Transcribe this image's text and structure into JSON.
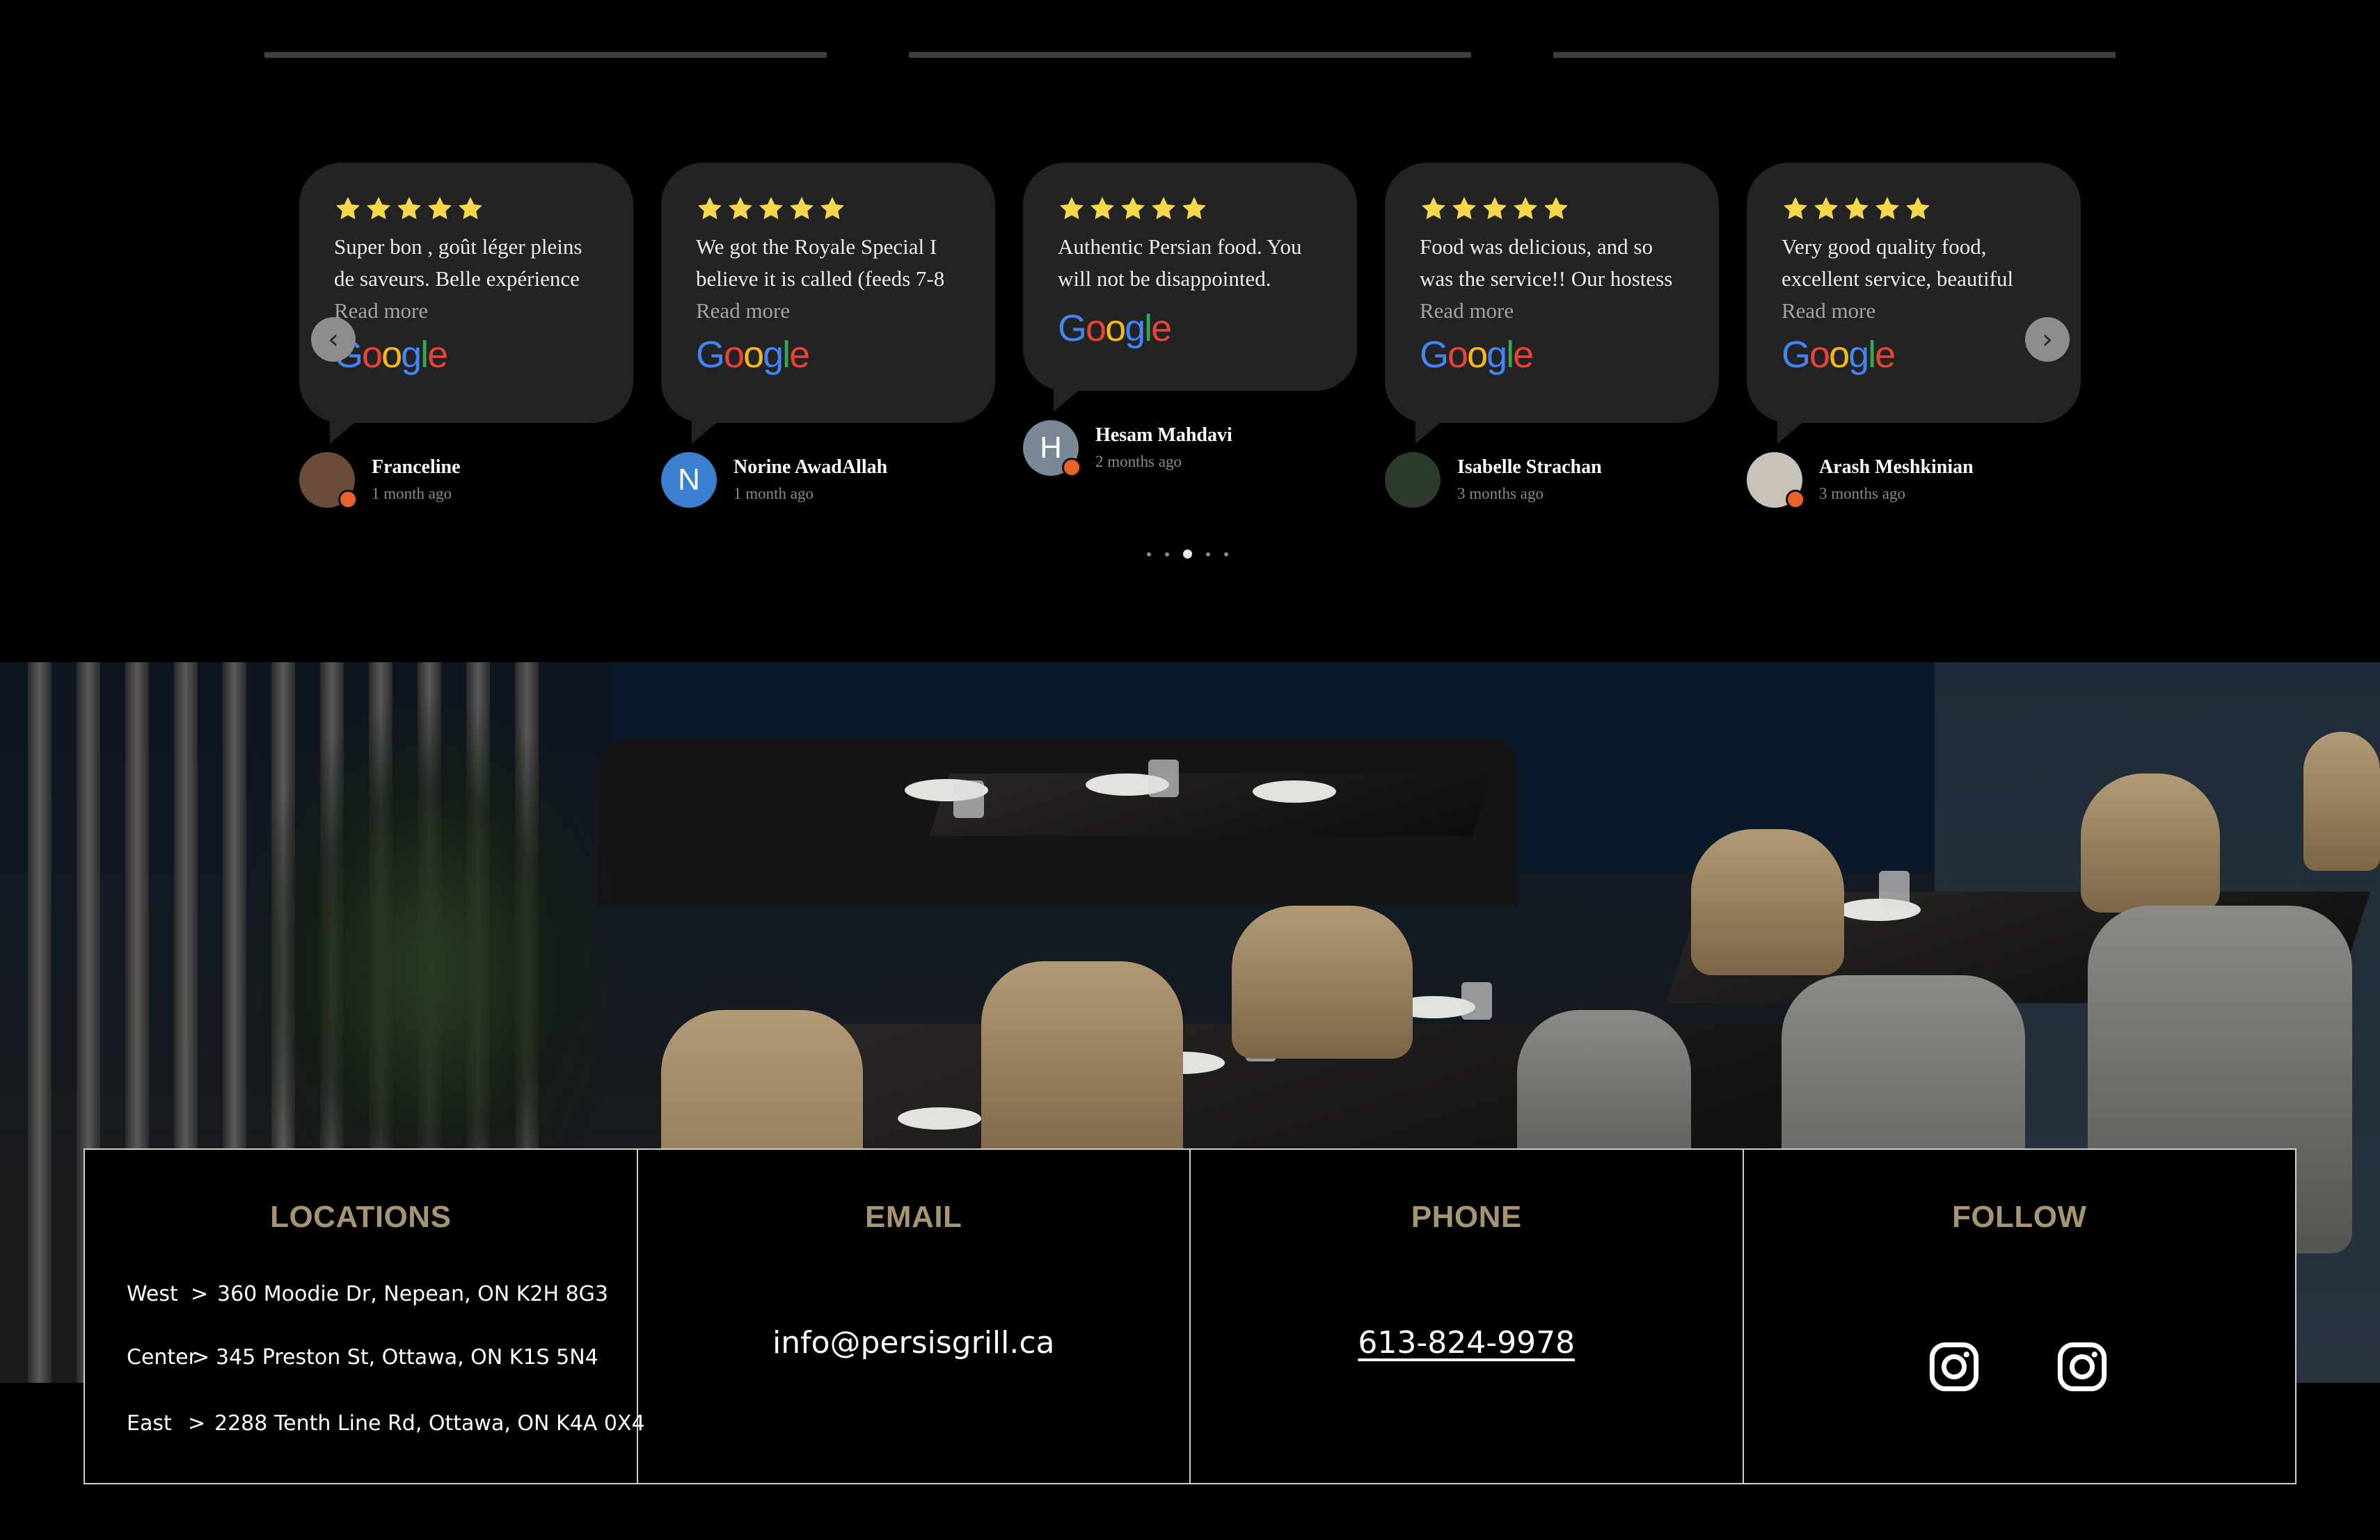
{
  "reviews": [
    {
      "text": "Super bon , goût léger pleins de saveurs. Belle expérience",
      "read_more": "Read more",
      "name": "Franceline",
      "time": "1 month ago",
      "avatar_color": "#6b4c3b"
    },
    {
      "text": "We got the Royale Special I believe it is called (feeds 7-8",
      "read_more": "Read more",
      "name": "Norine AwadAllah",
      "time": "1 month ago",
      "avatar_letter": "N",
      "avatar_color": "#3b7fd1"
    },
    {
      "text": "Authentic Persian food. You will not be disappointed.",
      "name": "Hesam Mahdavi",
      "time": "2 months ago",
      "avatar_letter": "H",
      "avatar_color": "#7a8896"
    },
    {
      "text": "Food was delicious, and so was the service!! Our hostess",
      "read_more": "Read more",
      "name": "Isabelle Strachan",
      "time": "3 months ago",
      "avatar_color": "#2b3a2a"
    },
    {
      "text": "Very good quality food, excellent service, beautiful",
      "read_more": "Read more",
      "name": "Arash Meshkinian",
      "time": "3 months ago",
      "avatar_color": "#c9c2b8"
    }
  ],
  "rating_stars": 5,
  "star_color": "#f7d84a",
  "google_logo": {
    "G": "G",
    "o1": "o",
    "o2": "o",
    "g": "g",
    "l": "l",
    "e": "e"
  },
  "carousel": {
    "prev_icon": "chevron-left-icon",
    "next_icon": "chevron-right-icon",
    "dots_count": 5,
    "active_dot": 2
  },
  "info": {
    "locations_title": "LOCATIONS",
    "locations": [
      {
        "label": "West",
        "sep": ">",
        "address": "360 Moodie Dr, Nepean, ON K2H 8G3"
      },
      {
        "label": "Center",
        "sep": ">",
        "address": "345 Preston St, Ottawa, ON K1S 5N4"
      },
      {
        "label": "East",
        "sep": ">",
        "address": "2288 Tenth Line Rd, Ottawa, ON K4A 0X4"
      }
    ],
    "email_title": "EMAIL",
    "email": "info@persisgrill.ca",
    "phone_title": "PHONE",
    "phone": "613-824-9978",
    "follow_title": "FOLLOW",
    "social_icons": [
      "instagram-icon",
      "instagram-icon"
    ],
    "accent_color": "#a69572"
  }
}
